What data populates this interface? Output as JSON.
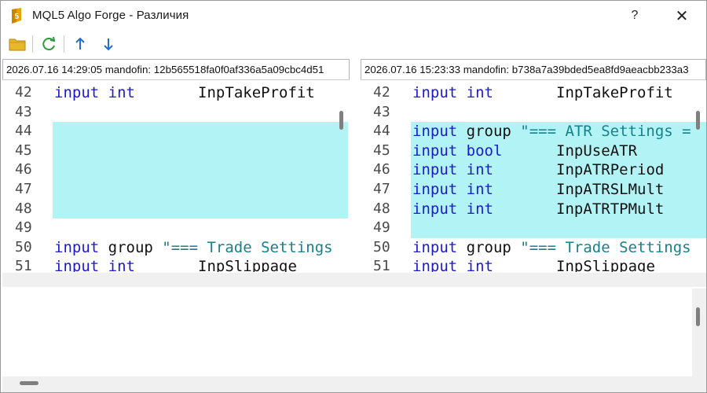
{
  "window": {
    "title": "MQL5 Algo Forge - Различия",
    "help_label": "?",
    "close_label": "✕"
  },
  "toolbar": {
    "icons": [
      "folder-icon",
      "refresh-icon",
      "arrow-up-icon",
      "arrow-down-icon"
    ]
  },
  "left": {
    "header": "2026.07.16 14:29:05 mandofin: 12b565518fa0f0af336a5a09cbc4d51",
    "lines": [
      {
        "num": "42",
        "hl": false,
        "tokens": [
          {
            "t": "input",
            "c": "kw"
          },
          {
            "t": " ",
            "c": "name"
          },
          {
            "t": "int",
            "c": "kw"
          },
          {
            "t": "       InpTakeProfit",
            "c": "name"
          }
        ]
      },
      {
        "num": "43",
        "hl": false,
        "tokens": []
      },
      {
        "num": "44",
        "hl": true,
        "tokens": []
      },
      {
        "num": "45",
        "hl": true,
        "tokens": []
      },
      {
        "num": "46",
        "hl": true,
        "tokens": []
      },
      {
        "num": "47",
        "hl": true,
        "tokens": []
      },
      {
        "num": "48",
        "hl": true,
        "tokens": []
      },
      {
        "num": "49",
        "hl": false,
        "tokens": []
      },
      {
        "num": "50",
        "hl": false,
        "tokens": [
          {
            "t": "input",
            "c": "kw"
          },
          {
            "t": " group ",
            "c": "name"
          },
          {
            "t": "\"=== Trade Settings",
            "c": "str"
          }
        ]
      },
      {
        "num": "51",
        "hl": false,
        "tokens": [
          {
            "t": "input",
            "c": "kw"
          },
          {
            "t": " ",
            "c": "name"
          },
          {
            "t": "int",
            "c": "kw"
          },
          {
            "t": "       InpSlippage",
            "c": "name"
          }
        ]
      }
    ]
  },
  "right": {
    "header": "2026.07.16 15:23:33 mandofin: b738a7a39bded5ea8fd9aeacbb233a3",
    "lines": [
      {
        "num": "42",
        "hl": false,
        "tokens": [
          {
            "t": "input",
            "c": "kw"
          },
          {
            "t": " ",
            "c": "name"
          },
          {
            "t": "int",
            "c": "kw"
          },
          {
            "t": "       InpTakeProfit",
            "c": "name"
          }
        ]
      },
      {
        "num": "43",
        "hl": false,
        "tokens": []
      },
      {
        "num": "44",
        "hl": true,
        "tokens": [
          {
            "t": "input",
            "c": "kw"
          },
          {
            "t": " group ",
            "c": "name"
          },
          {
            "t": "\"=== ATR Settings =",
            "c": "str"
          }
        ]
      },
      {
        "num": "45",
        "hl": true,
        "tokens": [
          {
            "t": "input",
            "c": "kw"
          },
          {
            "t": " ",
            "c": "name"
          },
          {
            "t": "bool",
            "c": "kw"
          },
          {
            "t": "      InpUseATR",
            "c": "name"
          }
        ]
      },
      {
        "num": "46",
        "hl": true,
        "tokens": [
          {
            "t": "input",
            "c": "kw"
          },
          {
            "t": " ",
            "c": "name"
          },
          {
            "t": "int",
            "c": "kw"
          },
          {
            "t": "       InpATRPeriod",
            "c": "name"
          }
        ]
      },
      {
        "num": "47",
        "hl": true,
        "tokens": [
          {
            "t": "input",
            "c": "kw"
          },
          {
            "t": " ",
            "c": "name"
          },
          {
            "t": "int",
            "c": "kw"
          },
          {
            "t": "       InpATRSLMult",
            "c": "name"
          }
        ]
      },
      {
        "num": "48",
        "hl": true,
        "tokens": [
          {
            "t": "input",
            "c": "kw"
          },
          {
            "t": " ",
            "c": "name"
          },
          {
            "t": "int",
            "c": "kw"
          },
          {
            "t": "       InpATRTPMult",
            "c": "name"
          }
        ]
      },
      {
        "num": "49",
        "hl": true,
        "tokens": []
      },
      {
        "num": "50",
        "hl": false,
        "tokens": [
          {
            "t": "input",
            "c": "kw"
          },
          {
            "t": " group ",
            "c": "name"
          },
          {
            "t": "\"=== Trade Settings",
            "c": "str"
          }
        ]
      },
      {
        "num": "51",
        "hl": false,
        "tokens": [
          {
            "t": "input",
            "c": "kw"
          },
          {
            "t": " ",
            "c": "name"
          },
          {
            "t": "int",
            "c": "kw"
          },
          {
            "t": "       InpSlippage",
            "c": "name"
          }
        ]
      }
    ]
  },
  "colors": {
    "highlight": "#b2f4f6",
    "keyword": "#1a1ad0",
    "string": "#17808a"
  }
}
